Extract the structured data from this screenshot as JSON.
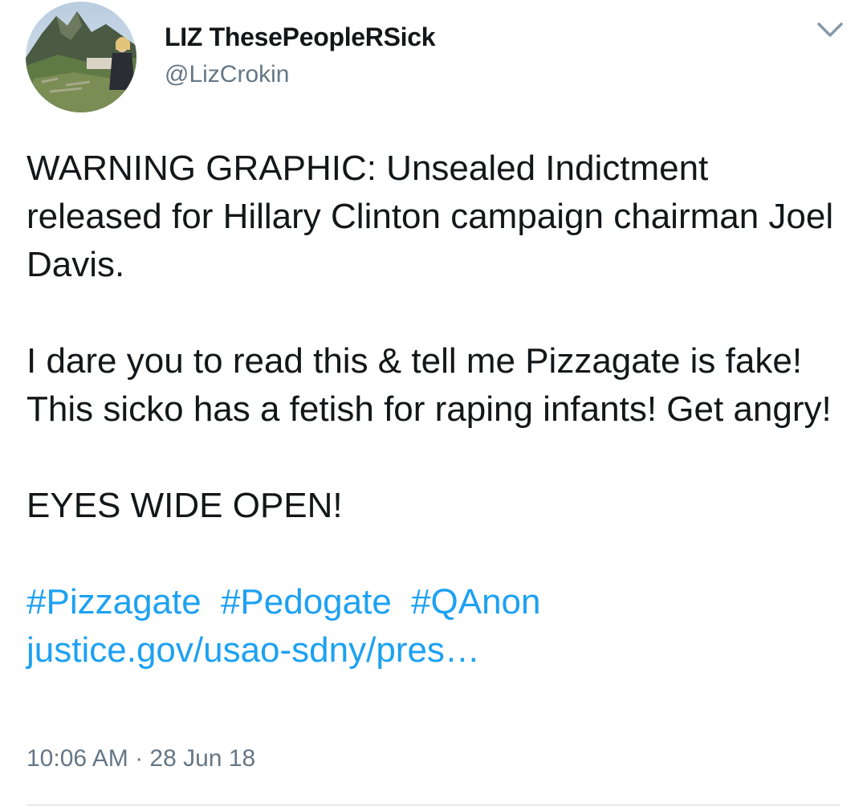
{
  "author": {
    "display_name": "LIZ ThesePeopleRSick",
    "handle": "@LizCrokin",
    "avatar_icon": "profile-photo"
  },
  "menu": {
    "icon": "chevron-down-icon"
  },
  "tweet": {
    "paragraphs": [
      "WARNING GRAPHIC: Unsealed Indictment released for Hillary Clinton campaign chairman Joel Davis.",
      "I dare you to read this & tell me Pizzagate is fake! This sicko has a fetish for raping infants! Get angry!",
      "EYES WIDE OPEN!"
    ],
    "hashtags": [
      "#Pizzagate",
      "#Pedogate",
      "#QAnon"
    ],
    "link_text": "justice.gov/usao-sdny/pres…",
    "timestamp": "10:06 AM · 28 Jun 18"
  },
  "colors": {
    "link": "#1da1f2",
    "text": "#14171a",
    "muted": "#657786"
  }
}
